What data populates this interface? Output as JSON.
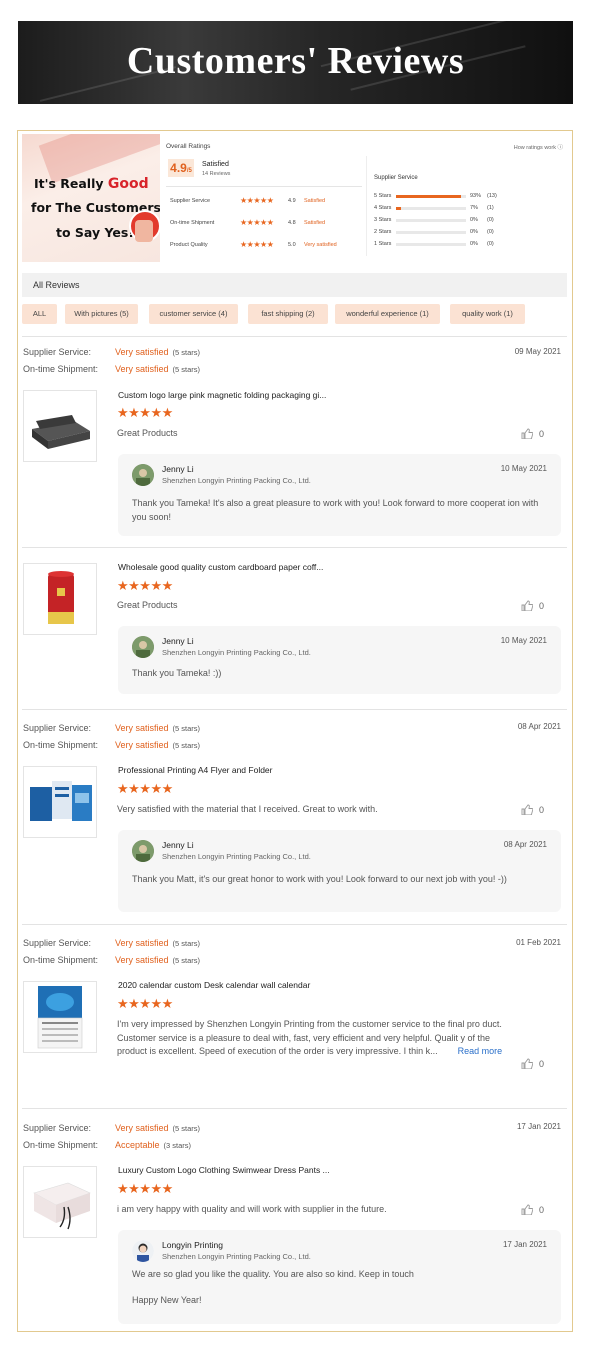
{
  "banner": {
    "title": "Customers' Reviews"
  },
  "promo": {
    "line1_a": "It's Really ",
    "line1_b": "Good",
    "line2": "for The Customers",
    "line3": "to Say Yes!"
  },
  "ratings": {
    "overall_label": "Overall Ratings",
    "how_label": "How ratings work",
    "score": "4.9",
    "score_suffix": "/5",
    "score_text": "Satisfied",
    "review_count": "14 Reviews",
    "services": [
      {
        "label": "Supplier Service",
        "stars": "★★★★★",
        "value": "4.9",
        "text": "Satisfied"
      },
      {
        "label": "On-time Shipment",
        "stars": "★★★★★",
        "value": "4.8",
        "text": "Satisfied"
      },
      {
        "label": "Product Quality",
        "stars": "★★★★★",
        "value": "5.0",
        "text": "Very satisfied"
      }
    ],
    "supplier_title": "Supplier Service",
    "distribution": [
      {
        "label": "5 Stars",
        "fraction": 0.93,
        "pct": "93%",
        "count": "(13)"
      },
      {
        "label": "4 Stars",
        "fraction": 0.07,
        "pct": "7%",
        "count": "(1)"
      },
      {
        "label": "3 Stars",
        "fraction": 0,
        "pct": "0%",
        "count": "(0)"
      },
      {
        "label": "2 Stars",
        "fraction": 0,
        "pct": "0%",
        "count": "(0)"
      },
      {
        "label": "1 Stars",
        "fraction": 0,
        "pct": "0%",
        "count": "(0)"
      }
    ]
  },
  "all_reviews": {
    "label": "All Reviews"
  },
  "filters": [
    "ALL",
    "With pictures (5)",
    "customer service (4)",
    "fast shipping (2)",
    "wonderful experience (1)",
    "quality work (1)"
  ],
  "labels": {
    "supplier_service": "Supplier Service:",
    "ontime_shipment": "On-time Shipment:",
    "stars5": "★★★★★",
    "likes": "0",
    "read_more": "Read more"
  },
  "reviews": [
    {
      "date": "09 May 2021",
      "supplier_value": "Very satisfied",
      "supplier_stars": "(5 stars)",
      "shipment_value": "Very satisfied",
      "shipment_stars": "(5 stars)",
      "title": "Custom logo large pink magnetic folding packaging gi...",
      "text": "Great Products",
      "reply": {
        "name": "Jenny Li",
        "company": "Shenzhen Longyin Printing Packing Co., Ltd.",
        "date": "10 May 2021",
        "msg": "Thank you Tameka!  It's also a great pleasure to work with you! Look forward to more cooperat ion with you soon!"
      }
    },
    {
      "title": "Wholesale good quality custom cardboard paper coff...",
      "text": "Great Products",
      "reply": {
        "name": "Jenny Li",
        "company": "Shenzhen Longyin Printing Packing Co., Ltd.",
        "date": "10 May 2021",
        "msg": "Thank you Tameka! :))"
      }
    },
    {
      "date": "08 Apr 2021",
      "supplier_value": "Very satisfied",
      "supplier_stars": "(5 stars)",
      "shipment_value": "Very satisfied",
      "shipment_stars": "(5 stars)",
      "title": "Professional Printing A4 Flyer and Folder",
      "text": "Very satisfied with the material that I received. Great to work with.",
      "reply": {
        "name": "Jenny Li",
        "company": "Shenzhen Longyin Printing Packing Co., Ltd.",
        "date": "08 Apr 2021",
        "msg": "Thank you Matt, it's our great honor to work with you! Look forward to our next job with you! -))"
      }
    },
    {
      "date": "01 Feb 2021",
      "supplier_value": "Very satisfied",
      "supplier_stars": "(5 stars)",
      "shipment_value": "Very satisfied",
      "shipment_stars": "(5 stars)",
      "title": "2020 calendar custom Desk calendar wall calendar",
      "text": "I'm very impressed by Shenzhen Longyin Printing from the customer service to the final pro duct. Customer service is a pleasure to deal with, fast, very efficient and very helpful. Qualit y of the product is excellent. Speed of execution of the order is very impressive. I thin k..."
    },
    {
      "date": "17 Jan 2021",
      "supplier_value": "Very satisfied",
      "supplier_stars": "(5 stars)",
      "shipment_value": "Acceptable",
      "shipment_stars": "(3 stars)",
      "title": "Luxury Custom Logo Clothing Swimwear Dress Pants ...",
      "text": "i am very happy with quality and will work with supplier in the future.",
      "reply": {
        "name": "Longyin Printing",
        "company": "Shenzhen Longyin Printing Packing Co., Ltd.",
        "date": "17 Jan 2021",
        "msg": "We are so glad you like the quality. You are also so kind. Keep in touch",
        "msg2": "Happy New Year!"
      }
    }
  ],
  "colors": {
    "accent": "#e0611e",
    "star": "#e8661f",
    "chip_bg": "#fbe2d3",
    "frame_border": "#e2c98f",
    "link": "#2a6fc9"
  },
  "icons": {
    "like": "thumbs-up-icon",
    "help": "question-icon"
  }
}
